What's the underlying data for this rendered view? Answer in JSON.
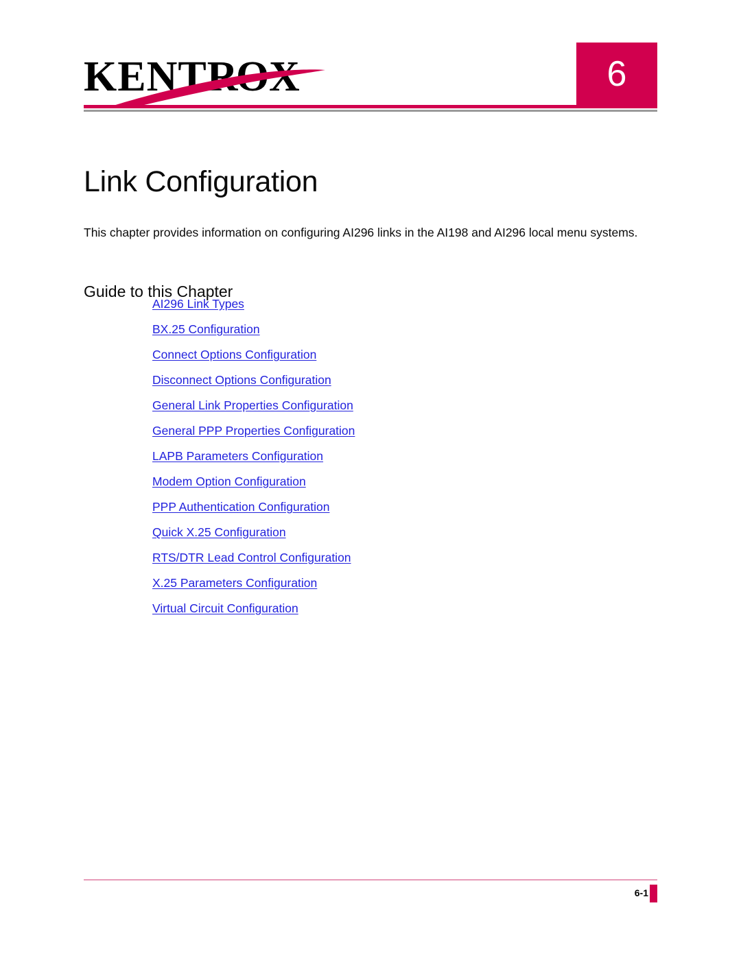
{
  "header": {
    "logo_text": "KENTROX",
    "logo_icon": "kentrox-swoosh-logo",
    "chapter_number": "6",
    "accent_color": "#D1004E",
    "rule_gray_color": "#9a9a9a"
  },
  "document": {
    "title": "Link Configuration",
    "intro": "This chapter provides information on configuring AI296 links in the AI198 and AI296 local menu systems.",
    "section_heading": "Guide to this Chapter"
  },
  "toc": {
    "link_color": "#2222DD",
    "items": [
      {
        "label": "AI296 Link Types"
      },
      {
        "label": "BX.25 Configuration"
      },
      {
        "label": "Connect Options Configuration"
      },
      {
        "label": "Disconnect Options Configuration"
      },
      {
        "label": "General Link Properties Configuration"
      },
      {
        "label": "General PPP Properties Configuration"
      },
      {
        "label": "LAPB Parameters Configuration"
      },
      {
        "label": "Modem Option Configuration"
      },
      {
        "label": "PPP Authentication Configuration"
      },
      {
        "label": "Quick X.25 Configuration"
      },
      {
        "label": "RTS/DTR Lead Control Configuration"
      },
      {
        "label": "X.25 Parameters Configuration"
      },
      {
        "label": "Virtual Circuit Configuration"
      }
    ]
  },
  "footer": {
    "page_number": "6-1",
    "rule_color": "#E79BB8",
    "tab_color": "#D1004E"
  }
}
